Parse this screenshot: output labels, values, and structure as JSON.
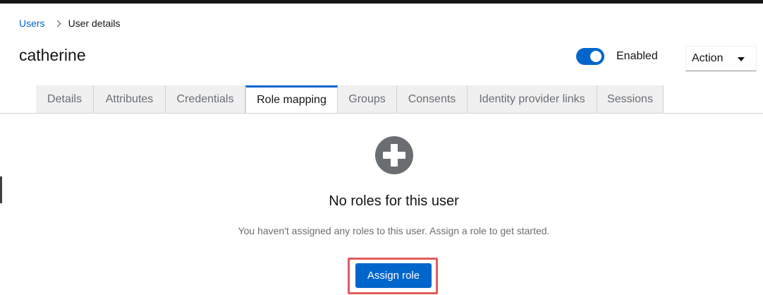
{
  "breadcrumb": {
    "parent": "Users",
    "current": "User details"
  },
  "page": {
    "title": "catherine"
  },
  "enabled_toggle": {
    "label": "Enabled",
    "on": true
  },
  "action_menu": {
    "label": "Action",
    "icon": "caret-down-icon"
  },
  "tabs": [
    {
      "label": "Details",
      "active": false
    },
    {
      "label": "Attributes",
      "active": false
    },
    {
      "label": "Credentials",
      "active": false
    },
    {
      "label": "Role mapping",
      "active": true
    },
    {
      "label": "Groups",
      "active": false
    },
    {
      "label": "Consents",
      "active": false
    },
    {
      "label": "Identity provider links",
      "active": false
    },
    {
      "label": "Sessions",
      "active": false
    }
  ],
  "empty_state": {
    "icon": "plus-circle-icon",
    "title": "No roles for this user",
    "body": "You haven't assigned any roles to this user. Assign a role to get started.",
    "button_label": "Assign role"
  },
  "colors": {
    "primary": "#0066cc",
    "highlight": "#e25c5c",
    "icon_gray": "#6a6e73"
  }
}
